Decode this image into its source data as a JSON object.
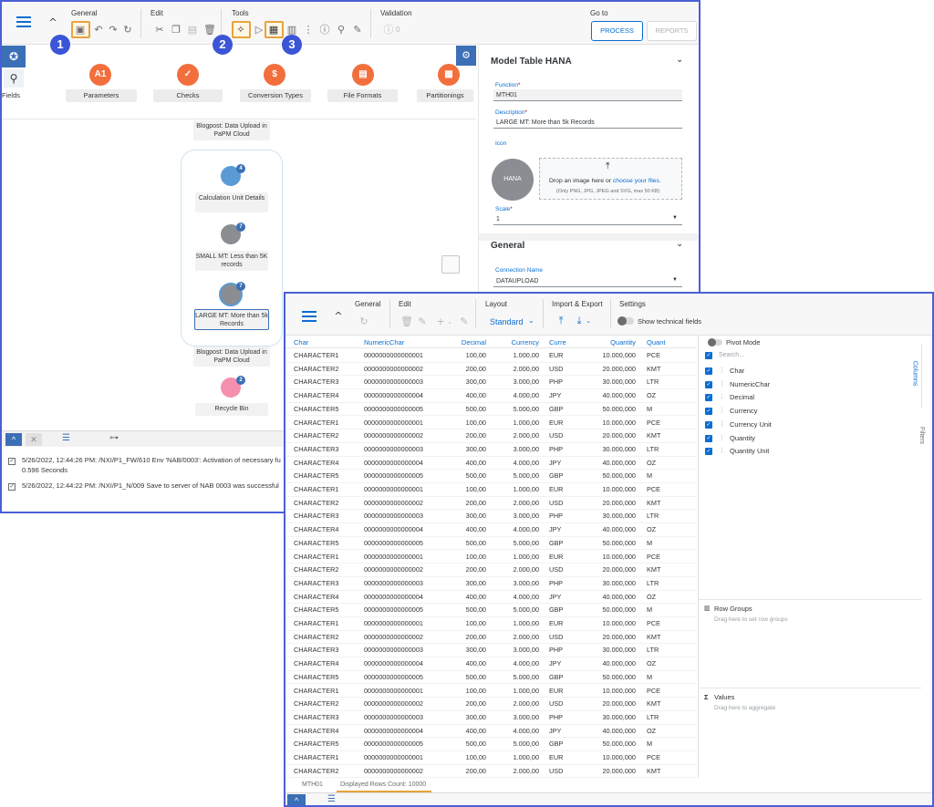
{
  "back_window": {
    "toolbar": {
      "groups": {
        "general": "General",
        "edit": "Edit",
        "tools": "Tools",
        "validation": "Validation",
        "goto": "Go to"
      },
      "validation_count": "0",
      "process_label": "PROCESS",
      "reports_label": "REPORTS"
    },
    "callouts": [
      "1",
      "2",
      "3"
    ],
    "categories": [
      {
        "label": "Fields",
        "icon": "fields-icon"
      },
      {
        "label": "Parameters",
        "icon": "parameters-icon",
        "glyph": "A1"
      },
      {
        "label": "Checks",
        "icon": "checks-icon"
      },
      {
        "label": "Conversion Types",
        "icon": "conversion-types-icon"
      },
      {
        "label": "File Formats",
        "icon": "file-formats-icon"
      },
      {
        "label": "Partitionings",
        "icon": "partitionings-icon"
      }
    ],
    "canvas": {
      "top_label": "Blogpost: Data Upload in PaPM Cloud",
      "nodes": [
        {
          "label": "Calculation Unit Details",
          "badge": "4"
        },
        {
          "label": "SMALL MT: Less than 5K records",
          "badge": "7"
        },
        {
          "label": "LARGE MT: More than 5k Records",
          "badge": "7"
        }
      ],
      "bottom_label": "Blogpost: Data Upload in PaPM Cloud",
      "recycle_label": "Recycle Bin",
      "recycle_badge": "2"
    },
    "messages": [
      "5/26/2022, 12:44:26 PM: /NXI/P1_FW/610 Env 'NAB/0003': Activation of necessary fu",
      "0.596 Seconds",
      "5/26/2022, 12:44:22 PM: /NXI/P1_N/009 Save to server of NAB 0003 was successful"
    ],
    "panel": {
      "title": "Model Table HANA",
      "function_label": "Function",
      "function_value": "MTH01",
      "description_label": "Description",
      "description_value": "LARGE MT: More than 5k Records",
      "icon_label": "Icon",
      "hana_text": "HANA",
      "drop_text": "Drop an image here or",
      "drop_link": "choose your files.",
      "drop_hint": "(Only PNG, JPG, JPEG and SVG, max 50 KB)",
      "scale_label": "Scale",
      "scale_value": "1",
      "general_title": "General",
      "connection_label": "Connection Name",
      "connection_value": "DATAUPLOAD"
    }
  },
  "front_window": {
    "toolbar": {
      "groups": {
        "general": "General",
        "edit": "Edit",
        "layout": "Layout",
        "import_export": "Import & Export",
        "settings": "Settings"
      },
      "layout_value": "Standard",
      "technical_label": "Show technical fields"
    },
    "columns": [
      "Char",
      "NumericChar",
      "Decimal",
      "Currency",
      "Curre",
      "Quantity",
      "Quant"
    ],
    "rows": [
      [
        "CHARACTER1",
        "0000000000000001",
        "100,00",
        "1.000,00",
        "EUR",
        "10.000,000",
        "PCE"
      ],
      [
        "CHARACTER2",
        "0000000000000002",
        "200,00",
        "2.000,00",
        "USD",
        "20.000,000",
        "KMT"
      ],
      [
        "CHARACTER3",
        "0000000000000003",
        "300,00",
        "3.000,00",
        "PHP",
        "30.000,000",
        "LTR"
      ],
      [
        "CHARACTER4",
        "0000000000000004",
        "400,00",
        "4.000,00",
        "JPY",
        "40.000,000",
        "OZ"
      ],
      [
        "CHARACTER5",
        "0000000000000005",
        "500,00",
        "5.000,00",
        "GBP",
        "50.000,000",
        "M"
      ],
      [
        "CHARACTER1",
        "0000000000000001",
        "100,00",
        "1.000,00",
        "EUR",
        "10.000,000",
        "PCE"
      ],
      [
        "CHARACTER2",
        "0000000000000002",
        "200,00",
        "2.000,00",
        "USD",
        "20.000,000",
        "KMT"
      ],
      [
        "CHARACTER3",
        "0000000000000003",
        "300,00",
        "3.000,00",
        "PHP",
        "30.000,000",
        "LTR"
      ],
      [
        "CHARACTER4",
        "0000000000000004",
        "400,00",
        "4.000,00",
        "JPY",
        "40.000,000",
        "OZ"
      ],
      [
        "CHARACTER5",
        "0000000000000005",
        "500,00",
        "5.000,00",
        "GBP",
        "50.000,000",
        "M"
      ],
      [
        "CHARACTER1",
        "0000000000000001",
        "100,00",
        "1.000,00",
        "EUR",
        "10.000,000",
        "PCE"
      ],
      [
        "CHARACTER2",
        "0000000000000002",
        "200,00",
        "2.000,00",
        "USD",
        "20.000,000",
        "KMT"
      ],
      [
        "CHARACTER3",
        "0000000000000003",
        "300,00",
        "3.000,00",
        "PHP",
        "30.000,000",
        "LTR"
      ],
      [
        "CHARACTER4",
        "0000000000000004",
        "400,00",
        "4.000,00",
        "JPY",
        "40.000,000",
        "OZ"
      ],
      [
        "CHARACTER5",
        "0000000000000005",
        "500,00",
        "5.000,00",
        "GBP",
        "50.000,000",
        "M"
      ],
      [
        "CHARACTER1",
        "0000000000000001",
        "100,00",
        "1.000,00",
        "EUR",
        "10.000,000",
        "PCE"
      ],
      [
        "CHARACTER2",
        "0000000000000002",
        "200,00",
        "2.000,00",
        "USD",
        "20.000,000",
        "KMT"
      ],
      [
        "CHARACTER3",
        "0000000000000003",
        "300,00",
        "3.000,00",
        "PHP",
        "30.000,000",
        "LTR"
      ],
      [
        "CHARACTER4",
        "0000000000000004",
        "400,00",
        "4.000,00",
        "JPY",
        "40.000,000",
        "OZ"
      ],
      [
        "CHARACTER5",
        "0000000000000005",
        "500,00",
        "5.000,00",
        "GBP",
        "50.000,000",
        "M"
      ],
      [
        "CHARACTER1",
        "0000000000000001",
        "100,00",
        "1.000,00",
        "EUR",
        "10.000,000",
        "PCE"
      ],
      [
        "CHARACTER2",
        "0000000000000002",
        "200,00",
        "2.000,00",
        "USD",
        "20.000,000",
        "KMT"
      ],
      [
        "CHARACTER3",
        "0000000000000003",
        "300,00",
        "3.000,00",
        "PHP",
        "30.000,000",
        "LTR"
      ],
      [
        "CHARACTER4",
        "0000000000000004",
        "400,00",
        "4.000,00",
        "JPY",
        "40.000,000",
        "OZ"
      ],
      [
        "CHARACTER5",
        "0000000000000005",
        "500,00",
        "5.000,00",
        "GBP",
        "50.000,000",
        "M"
      ],
      [
        "CHARACTER1",
        "0000000000000001",
        "100,00",
        "1.000,00",
        "EUR",
        "10.000,000",
        "PCE"
      ],
      [
        "CHARACTER2",
        "0000000000000002",
        "200,00",
        "2.000,00",
        "USD",
        "20.000,000",
        "KMT"
      ],
      [
        "CHARACTER3",
        "0000000000000003",
        "300,00",
        "3.000,00",
        "PHP",
        "30.000,000",
        "LTR"
      ],
      [
        "CHARACTER4",
        "0000000000000004",
        "400,00",
        "4.000,00",
        "JPY",
        "40.000,000",
        "OZ"
      ],
      [
        "CHARACTER5",
        "0000000000000005",
        "500,00",
        "5.000,00",
        "GBP",
        "50.000,000",
        "M"
      ],
      [
        "CHARACTER1",
        "0000000000000001",
        "100,00",
        "1.000,00",
        "EUR",
        "10.000,000",
        "PCE"
      ],
      [
        "CHARACTER2",
        "0000000000000002",
        "200,00",
        "2.000,00",
        "USD",
        "20.000,000",
        "KMT"
      ]
    ],
    "side": {
      "pivot_label": "Pivot Mode",
      "search_placeholder": "Search...",
      "column_items": [
        "Char",
        "NumericChar",
        "Decimal",
        "Currency",
        "Currency Unit",
        "Quantity",
        "Quantity Unit"
      ],
      "columns_tab": "Columns",
      "filters_tab": "Filters",
      "row_groups_title": "Row Groups",
      "row_groups_hint": "Drag here to set row groups",
      "values_title": "Values",
      "values_hint": "Drag here to aggregate"
    },
    "footer": {
      "table_name": "MTH01",
      "rows_count": "Displayed Rows Count: 10000"
    }
  },
  "colors": {
    "accent": "#0a6ed1",
    "frame": "#4a5fd6",
    "highlight": "#e8a33d",
    "callout": "#3b55d6"
  }
}
